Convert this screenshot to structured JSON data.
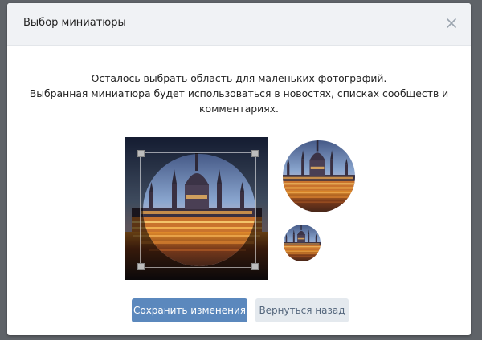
{
  "dialog": {
    "title": "Выбор миниатюры",
    "description_lines": [
      "Осталось выбрать область для маленьких фотографий.",
      "Выбранная миниатюра будет использоваться в новостях, списках сообществ и",
      "комментариях."
    ]
  },
  "buttons": {
    "save_label": "Сохранить изменения",
    "back_label": "Вернуться назад"
  },
  "colors": {
    "primary": "#5b88bd",
    "secondary": "#e4e9ee",
    "header_bg": "#f0f2f5"
  },
  "icons": {
    "close": "close-icon"
  }
}
